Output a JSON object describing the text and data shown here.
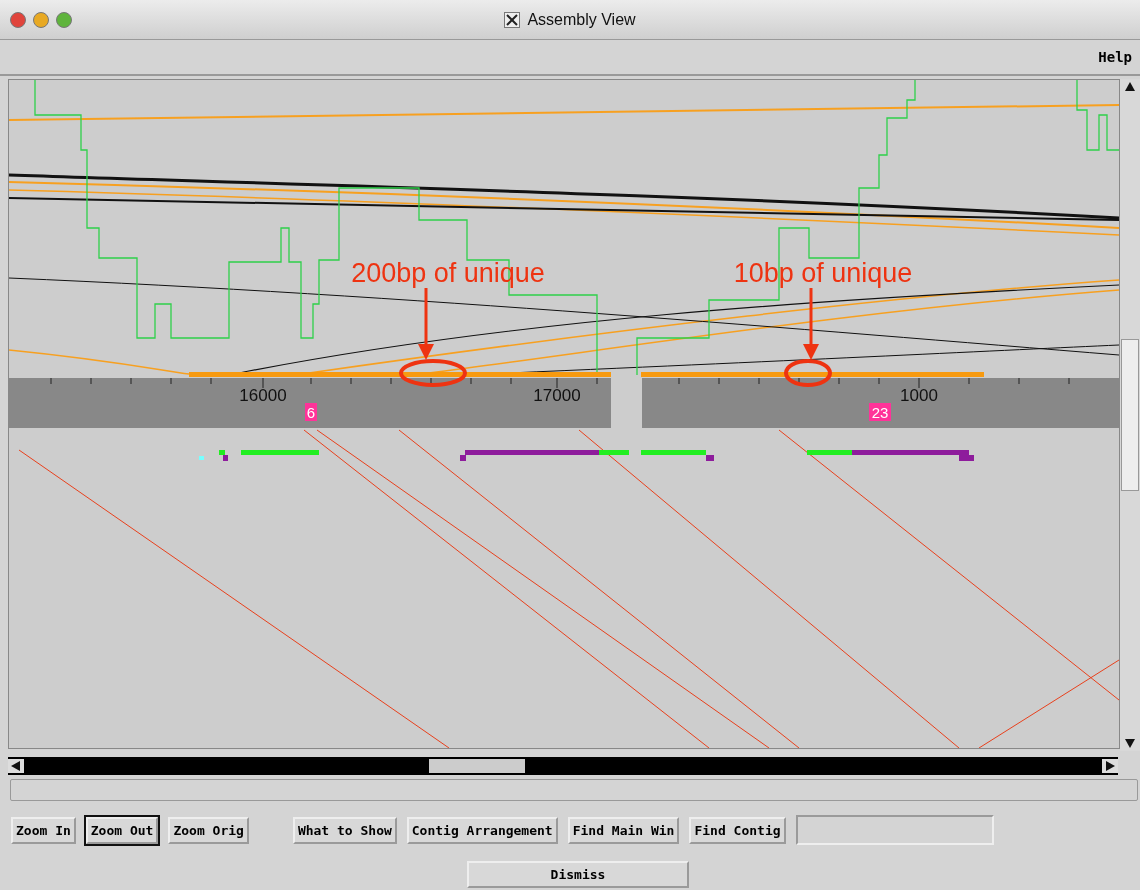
{
  "window": {
    "title": "Assembly View"
  },
  "menu": [
    "Help"
  ],
  "ruler": {
    "ticks": [
      {
        "label": "16000"
      },
      {
        "label": "17000"
      },
      {
        "label": "1000"
      }
    ],
    "contigs": [
      {
        "label": "6"
      },
      {
        "label": "23"
      }
    ]
  },
  "annotations": [
    {
      "text": "200bp of unique"
    },
    {
      "text": "10bp of unique"
    }
  ],
  "buttons": [
    {
      "label": "Zoom In",
      "selected": false
    },
    {
      "label": "Zoom Out",
      "selected": true
    },
    {
      "label": "Zoom Orig",
      "selected": false
    },
    {
      "label": "What to Show",
      "selected": false
    },
    {
      "label": "Contig Arrangement",
      "selected": false
    },
    {
      "label": "Find Main Win",
      "selected": false
    },
    {
      "label": "Find Contig",
      "selected": false
    }
  ],
  "dismiss": "Dismiss"
}
